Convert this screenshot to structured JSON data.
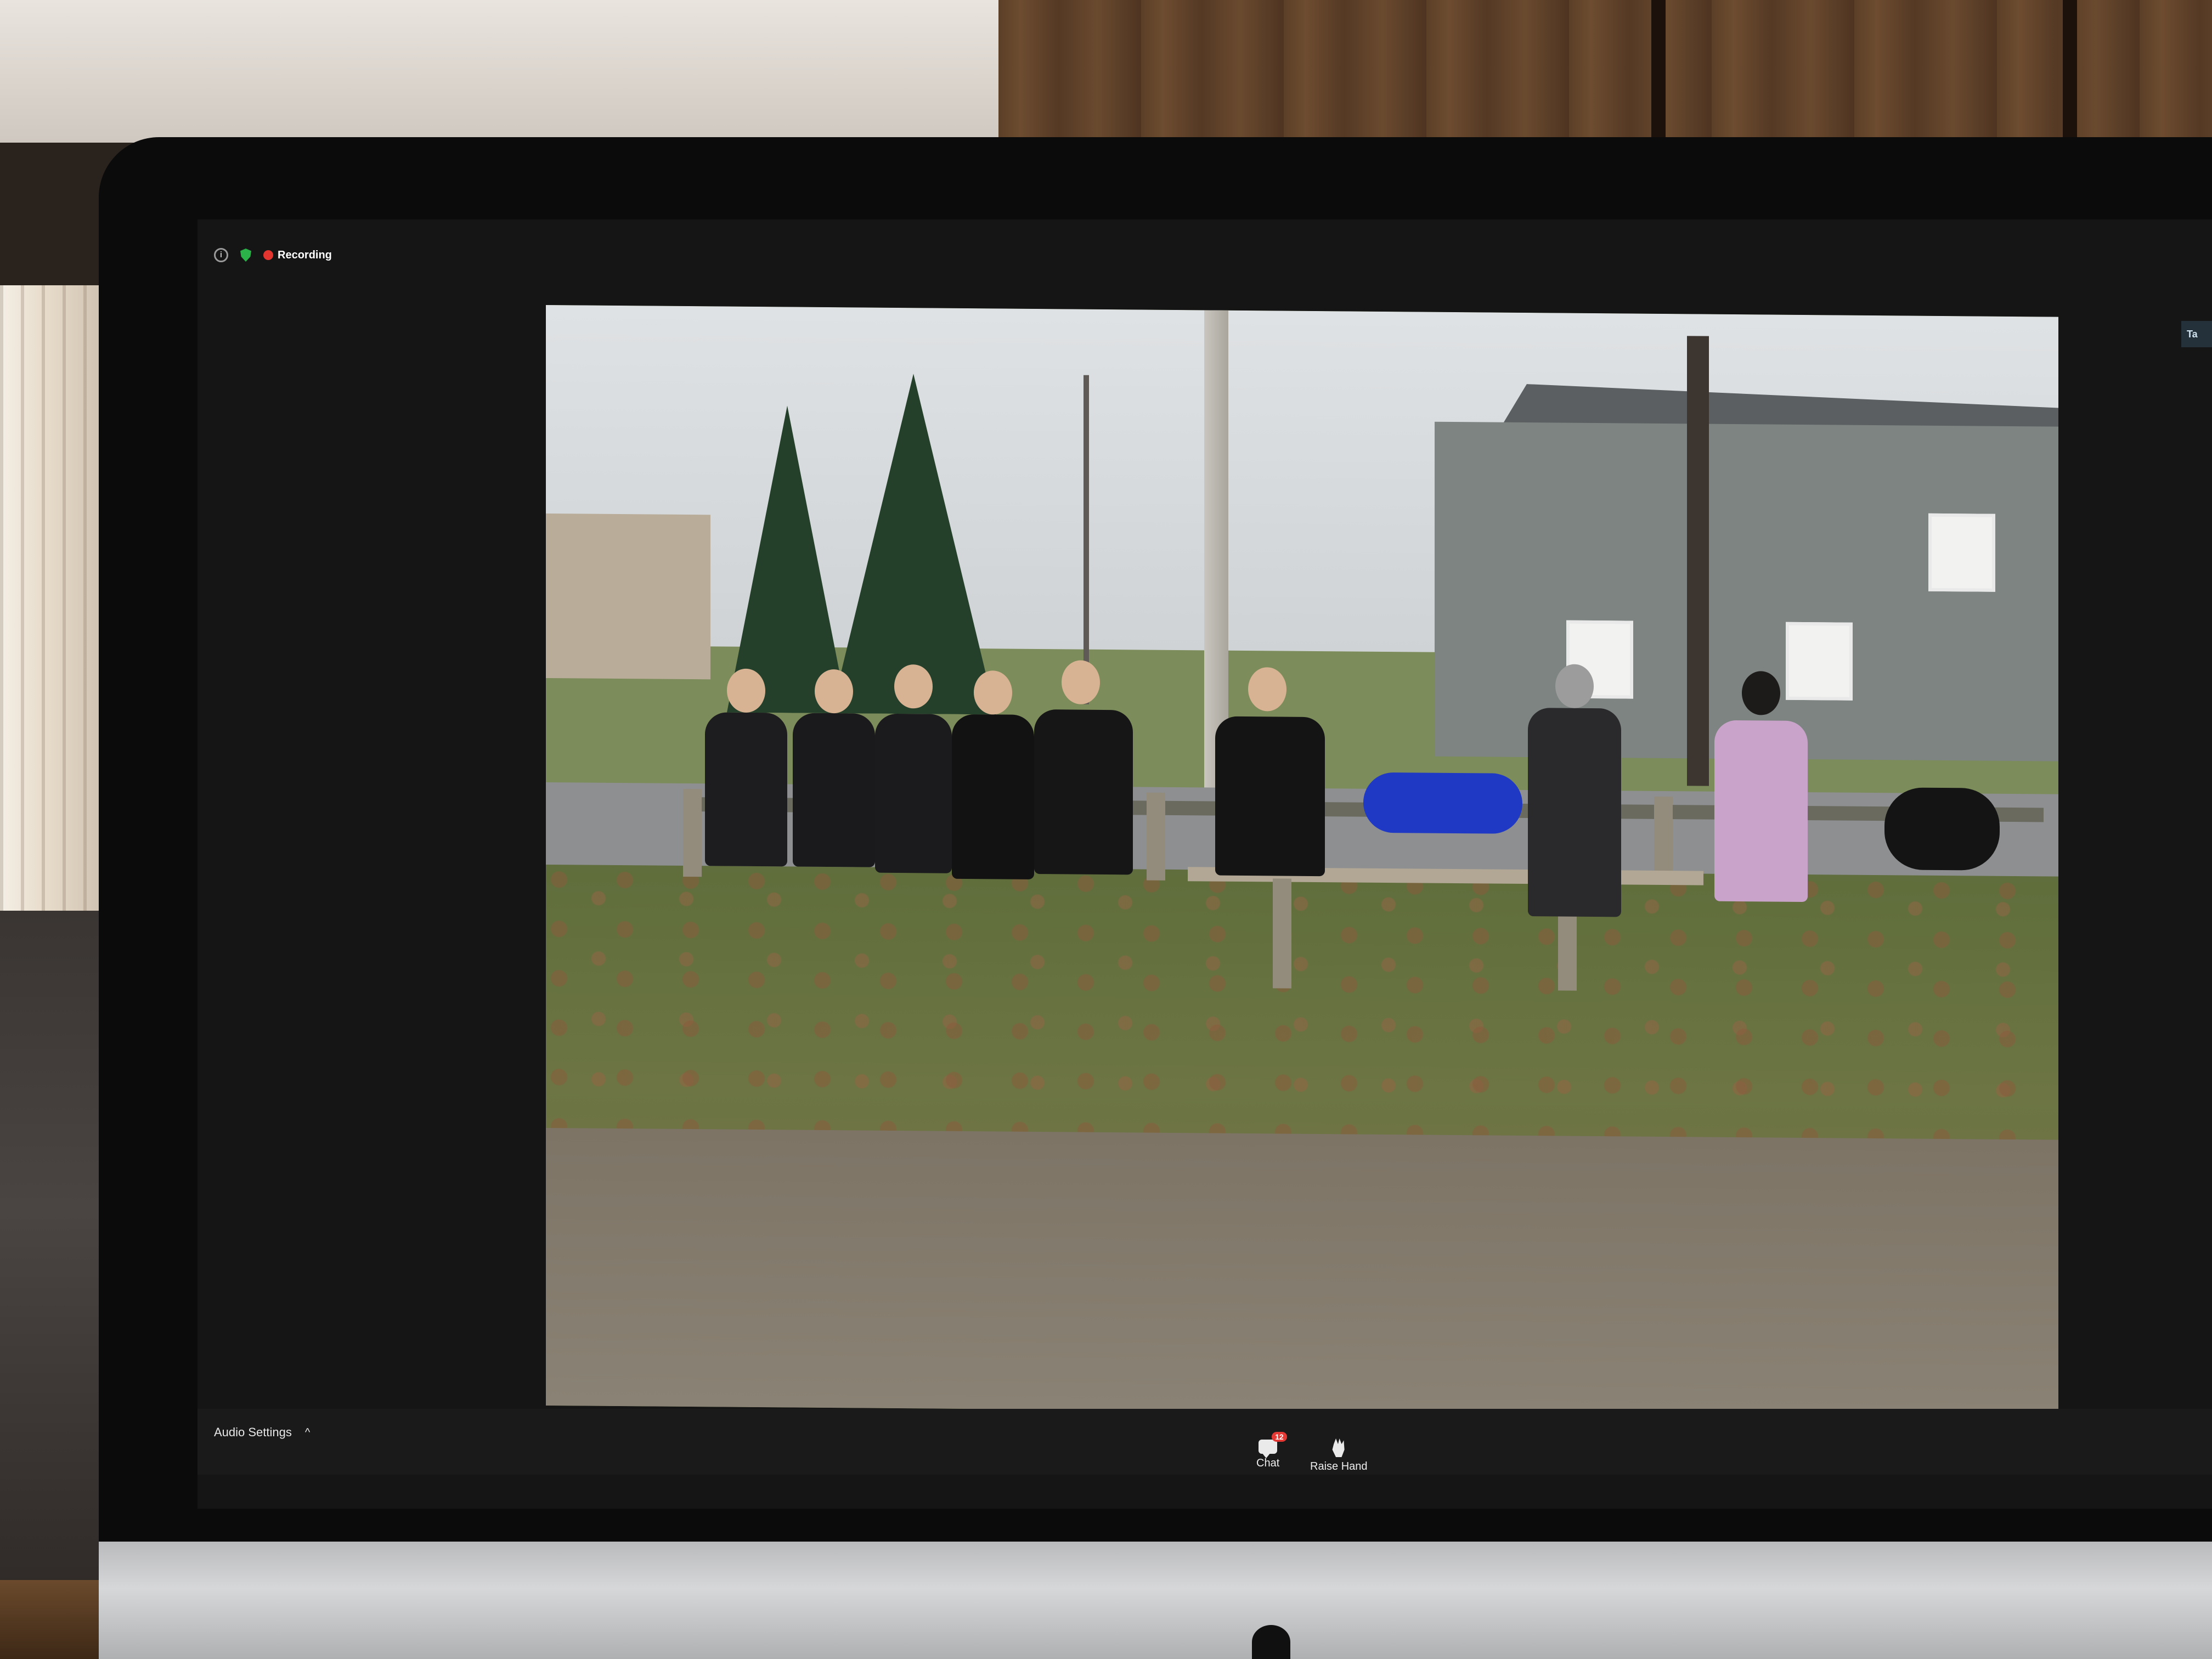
{
  "meeting": {
    "recording_label": "Recording",
    "side_tab_label": "Ta"
  },
  "toolbar": {
    "audio_settings_label": "Audio Settings",
    "chat_label": "Chat",
    "chat_badge": "12",
    "raise_hand_label": "Raise Hand"
  },
  "colors": {
    "recording": "#e3352f",
    "shield": "#2bb34a",
    "badge": "#e53935"
  },
  "icons": [
    "info-icon",
    "shield-icon",
    "recording-dot-icon",
    "caret-up-icon",
    "chat-icon",
    "raise-hand-icon"
  ]
}
